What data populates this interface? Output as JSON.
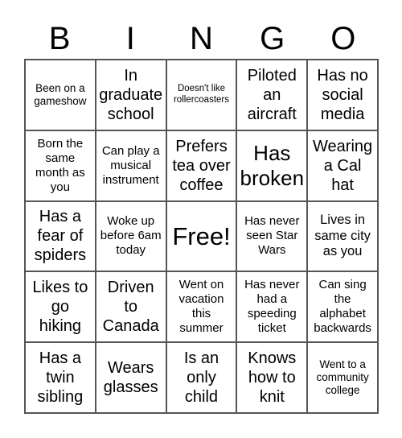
{
  "header": [
    "B",
    "I",
    "N",
    "G",
    "O"
  ],
  "cells": [
    "Been on a gameshow",
    "In graduate school",
    "Doesn't like rollercoasters",
    "Piloted an aircraft",
    "Has no social media",
    "Born the same month as you",
    "Can play a musical instrument",
    "Prefers tea over coffee",
    "Has broken",
    "Wearing a Cal hat",
    "Has a fear of spiders",
    "Woke up before 6am today",
    "Free!",
    "Has never seen Star Wars",
    "Lives in same city as you",
    "Likes to go hiking",
    "Driven to Canada",
    "Went on vacation this summer",
    "Has never had a speeding ticket",
    "Can sing the alphabet backwards",
    "Has a twin sibling",
    "Wears glasses",
    "Is an only child",
    "Knows how to knit",
    "Went to a community college"
  ]
}
